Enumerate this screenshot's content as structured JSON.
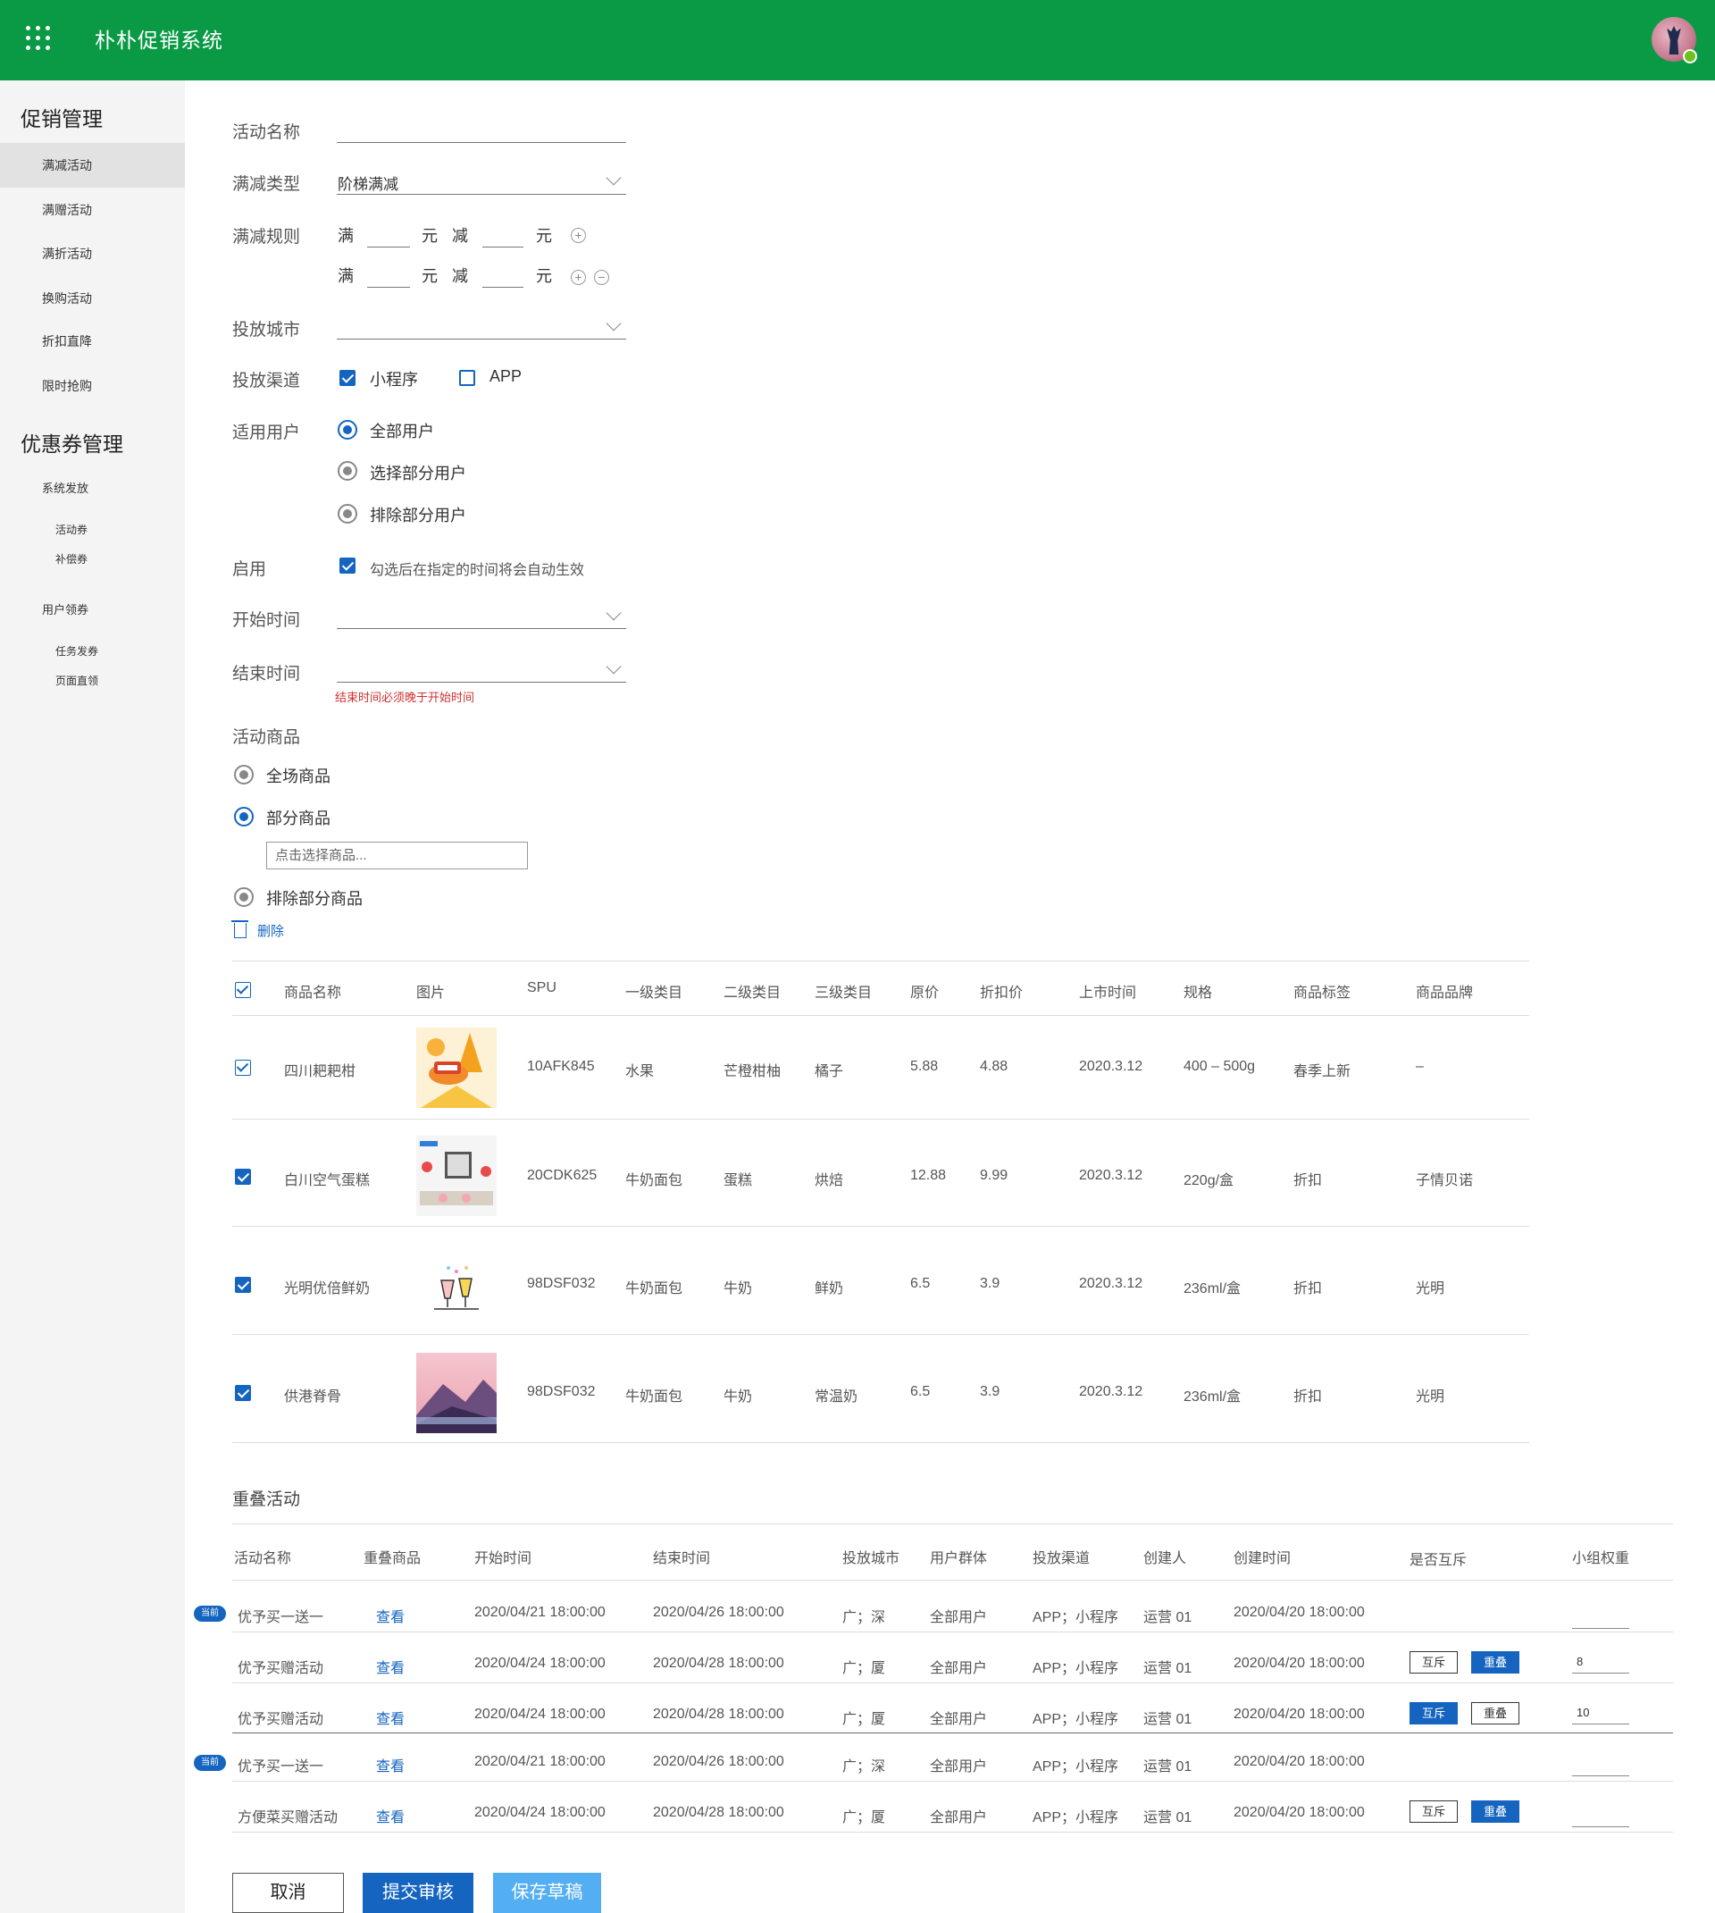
{
  "header": {
    "title": "朴朴促销系统",
    "menu_icon": "grid-icon",
    "avatar_icon": "avatar",
    "status_color": "#6ec11e",
    "bg_color": "#0a9a45"
  },
  "sidebar": {
    "group1": "促销管理",
    "items1": [
      "满减活动",
      "满赠活动",
      "满折活动",
      "换购活动",
      "折扣直降",
      "限时抢购"
    ],
    "group2": "优惠券管理",
    "sys_issue": "系统发放",
    "sys_sub": [
      "活动券",
      "补偿券"
    ],
    "user_claim": "用户领券",
    "user_sub": [
      "任务发券",
      "页面直领"
    ]
  },
  "form": {
    "activity_name_label": "活动名称",
    "type_label": "满减类型",
    "type_value": "阶梯满减",
    "rule_label": "满减规则",
    "rule_full": "满",
    "rule_yuan": "元",
    "rule_minus": "减",
    "rule_add": "+",
    "rule_remove": "−",
    "city_label": "投放城市",
    "channel_label": "投放渠道",
    "channel_options": [
      "小程序",
      "APP"
    ],
    "user_label": "适用用户",
    "user_options": [
      "全部用户",
      "选择部分用户",
      "排除部分用户"
    ],
    "enable_label": "启用",
    "enable_hint": "勾选后在指定的时间将会自动生效",
    "start_label": "开始时间",
    "end_label": "结束时间",
    "end_error": "结束时间必须晚于开始时间",
    "goods_label": "活动商品",
    "goods_options": [
      "全场商品",
      "部分商品",
      "排除部分商品"
    ],
    "goods_placeholder": "点击选择商品...",
    "delete_label": "删除"
  },
  "product_table": {
    "headers": [
      "商品名称",
      "图片",
      "SPU",
      "一级类目",
      "二级类目",
      "三级类目",
      "原价",
      "折扣价",
      "上市时间",
      "规格",
      "商品标签",
      "商品品牌"
    ],
    "rows": [
      {
        "name": "四川耙耙柑",
        "spu": "10AFK845",
        "cat1": "水果",
        "cat2": "芒橙柑柚",
        "cat3": "橘子",
        "price": "5.88",
        "discount": "4.88",
        "date": "2020.3.12",
        "spec": "400 – 500g",
        "tag": "春季上新",
        "brand": "–"
      },
      {
        "name": "白川空气蛋糕",
        "spu": "20CDK625",
        "cat1": "牛奶面包",
        "cat2": "蛋糕",
        "cat3": "烘焙",
        "price": "12.88",
        "discount": "9.99",
        "date": "2020.3.12",
        "spec": "220g/盒",
        "tag": "折扣",
        "brand": "子情贝诺"
      },
      {
        "name": "光明优倍鲜奶",
        "spu": "98DSF032",
        "cat1": "牛奶面包",
        "cat2": "牛奶",
        "cat3": "鲜奶",
        "price": "6.5",
        "discount": "3.9",
        "date": "2020.3.12",
        "spec": "236ml/盒",
        "tag": "折扣",
        "brand": "光明"
      },
      {
        "name": "供港脊骨",
        "spu": "98DSF032",
        "cat1": "牛奶面包",
        "cat2": "牛奶",
        "cat3": "常温奶",
        "price": "6.5",
        "discount": "3.9",
        "date": "2020.3.12",
        "spec": "236ml/盒",
        "tag": "折扣",
        "brand": "光明"
      }
    ]
  },
  "overlap": {
    "title": "重叠活动",
    "headers": [
      "活动名称",
      "重叠商品",
      "开始时间",
      "结束时间",
      "投放城市",
      "用户群体",
      "投放渠道",
      "创建人",
      "创建时间",
      "是否互斥",
      "小组权重"
    ],
    "current_badge": "当前",
    "view_label": "查看",
    "mutex_label": "互斥",
    "stack_label": "重叠",
    "rows": [
      {
        "current": true,
        "name": "优予买一送一",
        "start": "2020/04/21 18:00:00",
        "end": "2020/04/26 18:00:00",
        "city": "广；深",
        "users": "全部用户",
        "channel": "APP；小程序",
        "creator": "运营 01",
        "created": "2020/04/20 18:00:00",
        "mutex": "",
        "weight": ""
      },
      {
        "current": false,
        "name": "优予买赠活动",
        "start": "2020/04/24 18:00:00",
        "end": "2020/04/28 18:00:00",
        "city": "广；厦",
        "users": "全部用户",
        "channel": "APP；小程序",
        "creator": "运营 01",
        "created": "2020/04/20 18:00:00",
        "mutex": "stack",
        "weight": "8"
      },
      {
        "current": false,
        "name": "优予买赠活动",
        "start": "2020/04/24 18:00:00",
        "end": "2020/04/28 18:00:00",
        "city": "广；厦",
        "users": "全部用户",
        "channel": "APP；小程序",
        "creator": "运营 01",
        "created": "2020/04/20 18:00:00",
        "mutex": "mutex",
        "weight": "10"
      },
      {
        "current": true,
        "name": "优予买一送一",
        "start": "2020/04/21 18:00:00",
        "end": "2020/04/26 18:00:00",
        "city": "广；深",
        "users": "全部用户",
        "channel": "APP；小程序",
        "creator": "运营 01",
        "created": "2020/04/20 18:00:00",
        "mutex": "",
        "weight": ""
      },
      {
        "current": false,
        "name": "方便菜买赠活动",
        "start": "2020/04/24 18:00:00",
        "end": "2020/04/28 18:00:00",
        "city": "广；厦",
        "users": "全部用户",
        "channel": "APP；小程序",
        "creator": "运营 01",
        "created": "2020/04/20 18:00:00",
        "mutex": "stack",
        "weight": ""
      }
    ]
  },
  "actions": {
    "cancel": "取消",
    "submit": "提交审核",
    "draft": "保存草稿"
  }
}
